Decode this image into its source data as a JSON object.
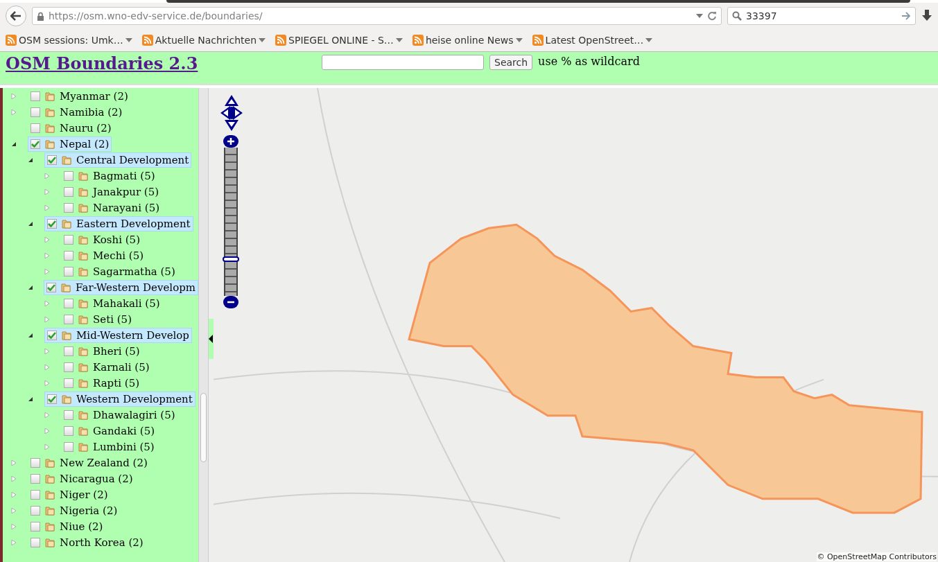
{
  "browser": {
    "url": "https://osm.wno-edv-service.de/boundaries/",
    "search_value": "33397",
    "bookmarks": [
      "OSM sessions: Umk…",
      "Aktuelle Nachrichten",
      "SPIEGEL ONLINE - S…",
      "heise online News",
      "Latest OpenStreet…"
    ]
  },
  "header": {
    "title": "OSM Boundaries 2.3",
    "search_button": "Search",
    "hint": "use % as wildcard"
  },
  "tree": [
    {
      "label": "Myanmar (2)",
      "kind": "node",
      "expanded": false,
      "checked": false
    },
    {
      "label": "Namibia (2)",
      "kind": "node",
      "expanded": false,
      "checked": false
    },
    {
      "label": "Nauru (2)",
      "kind": "leaf",
      "checked": false
    },
    {
      "label": "Nepal (2)",
      "kind": "node",
      "expanded": true,
      "checked": true,
      "children": [
        {
          "label": "Central Development",
          "kind": "node",
          "expanded": true,
          "checked": true,
          "children": [
            {
              "label": "Bagmati (5)",
              "kind": "node",
              "expanded": false,
              "checked": false
            },
            {
              "label": "Janakpur (5)",
              "kind": "node",
              "expanded": false,
              "checked": false
            },
            {
              "label": "Narayani (5)",
              "kind": "node",
              "expanded": false,
              "checked": false
            }
          ]
        },
        {
          "label": "Eastern Development",
          "kind": "node",
          "expanded": true,
          "checked": true,
          "children": [
            {
              "label": "Koshi (5)",
              "kind": "node",
              "expanded": false,
              "checked": false
            },
            {
              "label": "Mechi (5)",
              "kind": "node",
              "expanded": false,
              "checked": false
            },
            {
              "label": "Sagarmatha (5)",
              "kind": "node",
              "expanded": false,
              "checked": false
            }
          ]
        },
        {
          "label": "Far-Western Developm",
          "kind": "node",
          "expanded": true,
          "checked": true,
          "children": [
            {
              "label": "Mahakali (5)",
              "kind": "node",
              "expanded": false,
              "checked": false
            },
            {
              "label": "Seti (5)",
              "kind": "node",
              "expanded": false,
              "checked": false
            }
          ]
        },
        {
          "label": "Mid-Western Develop",
          "kind": "node",
          "expanded": true,
          "checked": true,
          "children": [
            {
              "label": "Bheri (5)",
              "kind": "node",
              "expanded": false,
              "checked": false
            },
            {
              "label": "Karnali (5)",
              "kind": "node",
              "expanded": false,
              "checked": false
            },
            {
              "label": "Rapti (5)",
              "kind": "node",
              "expanded": false,
              "checked": false
            }
          ]
        },
        {
          "label": "Western Development",
          "kind": "node",
          "expanded": true,
          "checked": true,
          "children": [
            {
              "label": "Dhawalagiri (5)",
              "kind": "node",
              "expanded": false,
              "checked": false
            },
            {
              "label": "Gandaki (5)",
              "kind": "node",
              "expanded": false,
              "checked": false
            },
            {
              "label": "Lumbini (5)",
              "kind": "node",
              "expanded": false,
              "checked": false
            }
          ]
        }
      ]
    },
    {
      "label": "New Zealand (2)",
      "kind": "node",
      "expanded": false,
      "checked": false
    },
    {
      "label": "Nicaragua (2)",
      "kind": "node",
      "expanded": false,
      "checked": false
    },
    {
      "label": "Niger (2)",
      "kind": "node",
      "expanded": false,
      "checked": false
    },
    {
      "label": "Nigeria (2)",
      "kind": "node",
      "expanded": false,
      "checked": false
    },
    {
      "label": "Niue (2)",
      "kind": "node",
      "expanded": false,
      "checked": false
    },
    {
      "label": "North Korea (2)",
      "kind": "node",
      "expanded": false,
      "checked": false
    }
  ],
  "map": {
    "zoom": {
      "level": 0.25
    },
    "attribution": "© OpenStreetMap Contributors"
  }
}
